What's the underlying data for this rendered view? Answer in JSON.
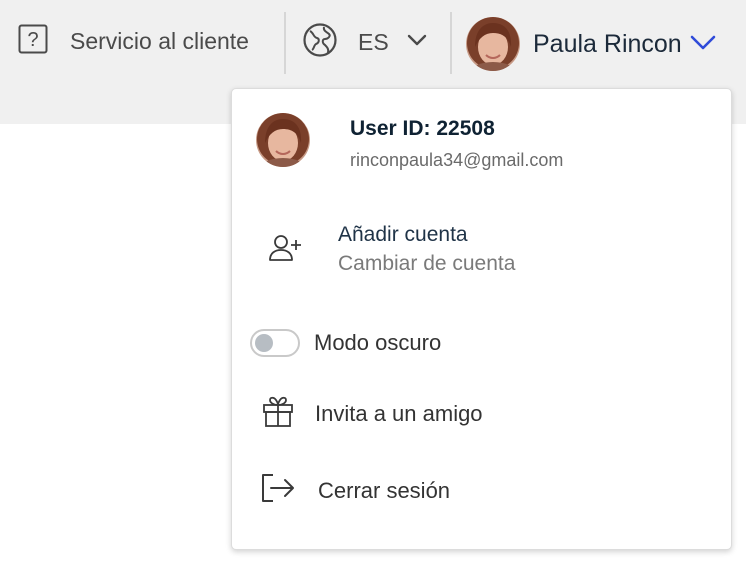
{
  "topbar": {
    "support_label": "Servicio al cliente",
    "language_label": "ES",
    "user_name": "Paula Rincon",
    "accent_color": "#2f4bd9"
  },
  "menu": {
    "user_id": "User ID: 22508",
    "email": "rinconpaula34@gmail.com",
    "add_account_title": "Añadir cuenta",
    "add_account_sub": "Cambiar de cuenta",
    "dark_mode_label": "Modo oscuro",
    "dark_mode_on": false,
    "invite_label": "Invita a un amigo",
    "logout_label": "Cerrar sesión"
  },
  "icons": {
    "support": "question-square-icon",
    "language": "globe-icon",
    "dropdown": "chevron-down-icon",
    "add_account": "add-user-icon",
    "invite": "gift-icon",
    "logout": "logout-icon"
  }
}
